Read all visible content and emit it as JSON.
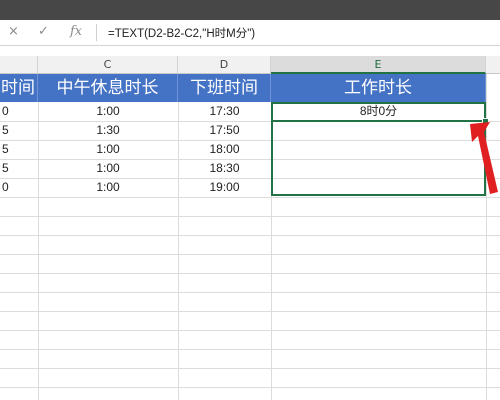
{
  "formula_bar": {
    "cancel_icon": "×",
    "enter_icon": "✓",
    "fx_label": "fx",
    "formula": "=TEXT(D2-B2-C2,\"H时M分\")"
  },
  "columns": [
    "C",
    "D",
    "E"
  ],
  "headers": {
    "b_partial": "时间",
    "c": "中午休息时长",
    "d": "下班时间",
    "e": "工作时长"
  },
  "rows": [
    {
      "b": "0",
      "c": "1:00",
      "d": "17:30",
      "e": "8时0分"
    },
    {
      "b": "5",
      "c": "1:30",
      "d": "17:50",
      "e": ""
    },
    {
      "b": "5",
      "c": "1:00",
      "d": "18:00",
      "e": ""
    },
    {
      "b": "5",
      "c": "1:00",
      "d": "18:30",
      "e": ""
    },
    {
      "b": "0",
      "c": "1:00",
      "d": "19:00",
      "e": ""
    }
  ],
  "annotation": {
    "arrow_color": "#e02020",
    "icon": "red-arrow-icon"
  },
  "colors": {
    "header_bg": "#4472c4",
    "selection": "#217346"
  }
}
